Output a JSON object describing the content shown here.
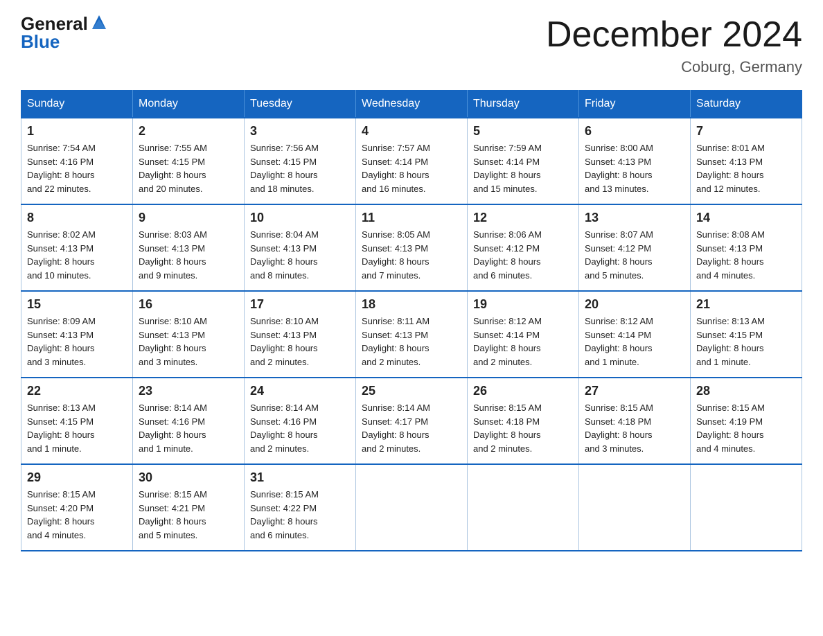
{
  "logo": {
    "line1": "General",
    "line2": "Blue"
  },
  "header": {
    "title": "December 2024",
    "subtitle": "Coburg, Germany"
  },
  "weekdays": [
    "Sunday",
    "Monday",
    "Tuesday",
    "Wednesday",
    "Thursday",
    "Friday",
    "Saturday"
  ],
  "weeks": [
    [
      {
        "day": "1",
        "sunrise": "7:54 AM",
        "sunset": "4:16 PM",
        "daylight": "8 hours and 22 minutes."
      },
      {
        "day": "2",
        "sunrise": "7:55 AM",
        "sunset": "4:15 PM",
        "daylight": "8 hours and 20 minutes."
      },
      {
        "day": "3",
        "sunrise": "7:56 AM",
        "sunset": "4:15 PM",
        "daylight": "8 hours and 18 minutes."
      },
      {
        "day": "4",
        "sunrise": "7:57 AM",
        "sunset": "4:14 PM",
        "daylight": "8 hours and 16 minutes."
      },
      {
        "day": "5",
        "sunrise": "7:59 AM",
        "sunset": "4:14 PM",
        "daylight": "8 hours and 15 minutes."
      },
      {
        "day": "6",
        "sunrise": "8:00 AM",
        "sunset": "4:13 PM",
        "daylight": "8 hours and 13 minutes."
      },
      {
        "day": "7",
        "sunrise": "8:01 AM",
        "sunset": "4:13 PM",
        "daylight": "8 hours and 12 minutes."
      }
    ],
    [
      {
        "day": "8",
        "sunrise": "8:02 AM",
        "sunset": "4:13 PM",
        "daylight": "8 hours and 10 minutes."
      },
      {
        "day": "9",
        "sunrise": "8:03 AM",
        "sunset": "4:13 PM",
        "daylight": "8 hours and 9 minutes."
      },
      {
        "day": "10",
        "sunrise": "8:04 AM",
        "sunset": "4:13 PM",
        "daylight": "8 hours and 8 minutes."
      },
      {
        "day": "11",
        "sunrise": "8:05 AM",
        "sunset": "4:13 PM",
        "daylight": "8 hours and 7 minutes."
      },
      {
        "day": "12",
        "sunrise": "8:06 AM",
        "sunset": "4:12 PM",
        "daylight": "8 hours and 6 minutes."
      },
      {
        "day": "13",
        "sunrise": "8:07 AM",
        "sunset": "4:12 PM",
        "daylight": "8 hours and 5 minutes."
      },
      {
        "day": "14",
        "sunrise": "8:08 AM",
        "sunset": "4:13 PM",
        "daylight": "8 hours and 4 minutes."
      }
    ],
    [
      {
        "day": "15",
        "sunrise": "8:09 AM",
        "sunset": "4:13 PM",
        "daylight": "8 hours and 3 minutes."
      },
      {
        "day": "16",
        "sunrise": "8:10 AM",
        "sunset": "4:13 PM",
        "daylight": "8 hours and 3 minutes."
      },
      {
        "day": "17",
        "sunrise": "8:10 AM",
        "sunset": "4:13 PM",
        "daylight": "8 hours and 2 minutes."
      },
      {
        "day": "18",
        "sunrise": "8:11 AM",
        "sunset": "4:13 PM",
        "daylight": "8 hours and 2 minutes."
      },
      {
        "day": "19",
        "sunrise": "8:12 AM",
        "sunset": "4:14 PM",
        "daylight": "8 hours and 2 minutes."
      },
      {
        "day": "20",
        "sunrise": "8:12 AM",
        "sunset": "4:14 PM",
        "daylight": "8 hours and 1 minute."
      },
      {
        "day": "21",
        "sunrise": "8:13 AM",
        "sunset": "4:15 PM",
        "daylight": "8 hours and 1 minute."
      }
    ],
    [
      {
        "day": "22",
        "sunrise": "8:13 AM",
        "sunset": "4:15 PM",
        "daylight": "8 hours and 1 minute."
      },
      {
        "day": "23",
        "sunrise": "8:14 AM",
        "sunset": "4:16 PM",
        "daylight": "8 hours and 1 minute."
      },
      {
        "day": "24",
        "sunrise": "8:14 AM",
        "sunset": "4:16 PM",
        "daylight": "8 hours and 2 minutes."
      },
      {
        "day": "25",
        "sunrise": "8:14 AM",
        "sunset": "4:17 PM",
        "daylight": "8 hours and 2 minutes."
      },
      {
        "day": "26",
        "sunrise": "8:15 AM",
        "sunset": "4:18 PM",
        "daylight": "8 hours and 2 minutes."
      },
      {
        "day": "27",
        "sunrise": "8:15 AM",
        "sunset": "4:18 PM",
        "daylight": "8 hours and 3 minutes."
      },
      {
        "day": "28",
        "sunrise": "8:15 AM",
        "sunset": "4:19 PM",
        "daylight": "8 hours and 4 minutes."
      }
    ],
    [
      {
        "day": "29",
        "sunrise": "8:15 AM",
        "sunset": "4:20 PM",
        "daylight": "8 hours and 4 minutes."
      },
      {
        "day": "30",
        "sunrise": "8:15 AM",
        "sunset": "4:21 PM",
        "daylight": "8 hours and 5 minutes."
      },
      {
        "day": "31",
        "sunrise": "8:15 AM",
        "sunset": "4:22 PM",
        "daylight": "8 hours and 6 minutes."
      },
      null,
      null,
      null,
      null
    ]
  ],
  "labels": {
    "sunrise": "Sunrise:",
    "sunset": "Sunset:",
    "daylight": "Daylight:"
  }
}
